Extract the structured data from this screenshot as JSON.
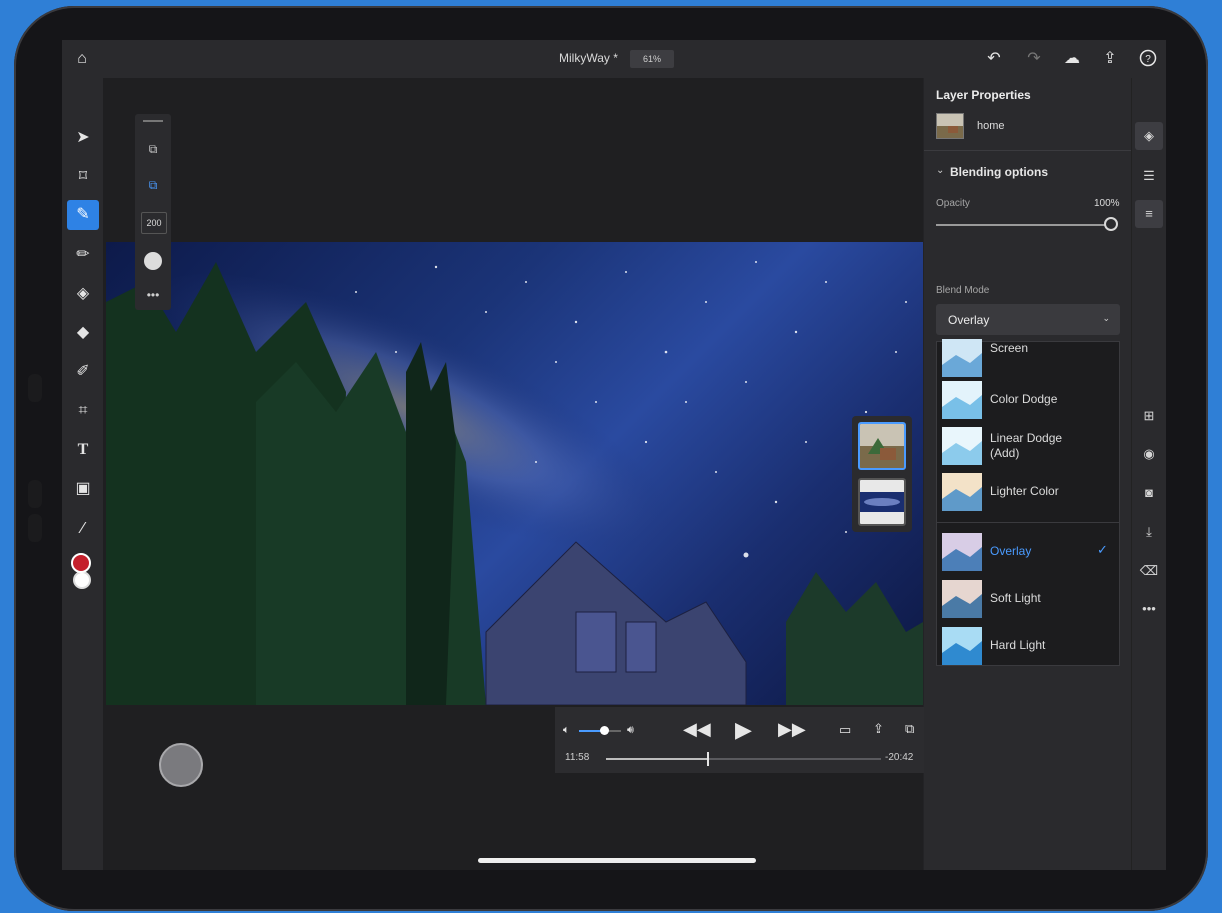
{
  "header": {
    "document_title": "MilkyWay *",
    "zoom_level": "61%",
    "icons": [
      "home-icon",
      "undo-icon",
      "redo-icon",
      "cloud-icon",
      "share-icon",
      "help-icon"
    ]
  },
  "toolbar": {
    "tools": [
      "select-icon",
      "transform-icon",
      "quick-selection-icon",
      "brush-icon",
      "eraser-icon",
      "paint-bucket-icon",
      "healing-icon",
      "crop-icon",
      "type-icon",
      "image-icon",
      "eyedropper-icon"
    ],
    "active_tool": "quick-selection-icon",
    "foreground_color": "#c4202c",
    "background_color": "#ffffff"
  },
  "tool_options": {
    "brush_size": "200"
  },
  "video_player": {
    "elapsed": "11:58",
    "remaining": "-20:42",
    "progress": 0.37,
    "volume": 0.6
  },
  "layer_properties": {
    "title": "Layer Properties",
    "layer_name": "home",
    "blending_section": "Blending options",
    "opacity_label": "Opacity",
    "opacity_value": "100%",
    "blend_mode_label": "Blend Mode",
    "blend_mode_value": "Overlay",
    "blend_options": [
      {
        "label": "Screen",
        "selected": false
      },
      {
        "label": "Color Dodge",
        "selected": false
      },
      {
        "label": "Linear Dodge (Add)",
        "selected": false
      },
      {
        "label": "Lighter Color",
        "selected": false
      },
      {
        "label": "Overlay",
        "selected": true
      },
      {
        "label": "Soft Light",
        "selected": false
      },
      {
        "label": "Hard Light",
        "selected": false
      }
    ]
  },
  "right_rail": {
    "icons": [
      "layers-icon",
      "layer-details-icon",
      "adjustments-icon",
      "add-layer-icon",
      "visibility-icon",
      "mask-icon",
      "arrange-icon",
      "clear-icon",
      "more-icon"
    ]
  },
  "colors": {
    "accent": "#2e82e5",
    "selected_text": "#4a9bff",
    "panel_bg": "#2a2a2d"
  }
}
